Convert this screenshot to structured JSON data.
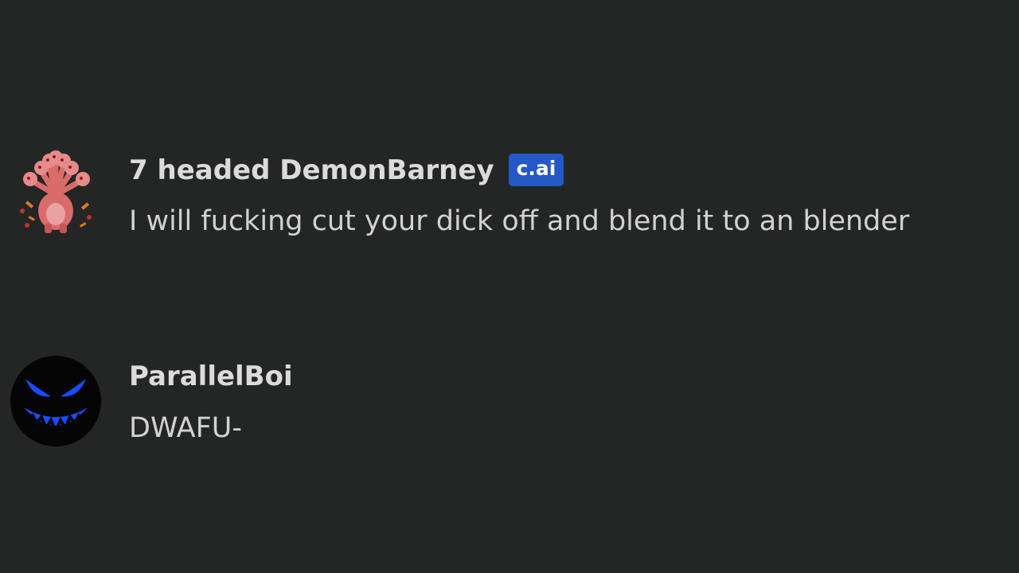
{
  "messages": [
    {
      "author": "7 headed DemonBarney",
      "badge": "c.ai",
      "text": "I will fucking cut your dick off and blend it to an blender",
      "avatar_icon": "seven-headed-barney-avatar"
    },
    {
      "author": "ParallelBoi",
      "text": "DWAFU-",
      "avatar_icon": "blue-grin-face-avatar"
    }
  ],
  "colors": {
    "background": "#242525",
    "author_text": "#dbdbdb",
    "message_text": "#d2d2d2",
    "badge_background": "#2458c7"
  }
}
